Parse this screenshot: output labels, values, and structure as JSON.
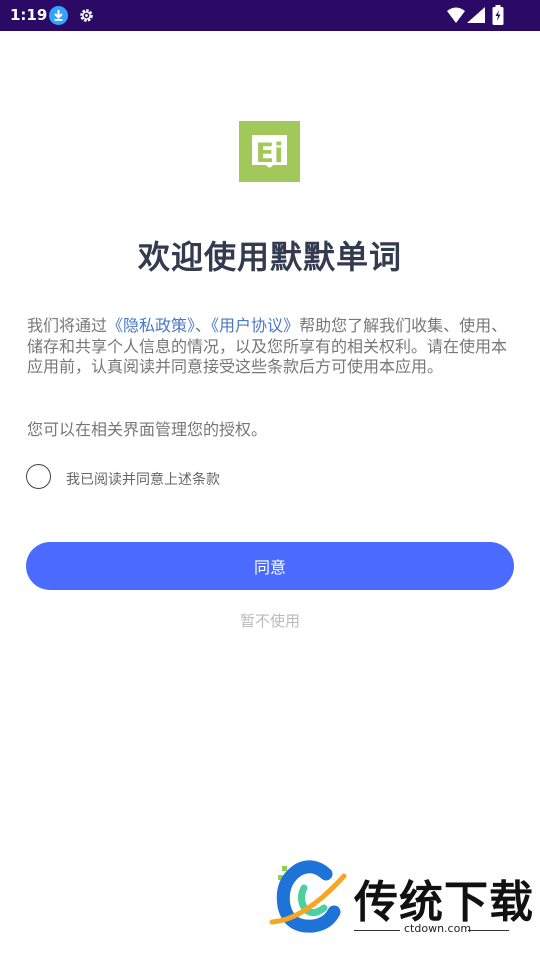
{
  "status_bar": {
    "time": "1:19",
    "bg_color": "#2a0a64",
    "icons": [
      "download-icon",
      "gear-icon",
      "wifi-icon",
      "signal-icon",
      "battery-icon"
    ]
  },
  "app": {
    "logo_letter": "Ei",
    "logo_color": "#a3c85a",
    "title": "欢迎使用默默单词"
  },
  "privacy": {
    "text_before": "我们将通过",
    "privacy_link": "《隐私政策》",
    "separator": "、",
    "agreement_link": "《用户协议》",
    "text_after": "帮助您了解我们收集、使用、储存和共享个人信息的情况，以及您所享有的相关权利。请在使用本应用前，认真阅读并同意接受这些条款后方可使用本应用。",
    "note": "您可以在相关界面管理您的授权。",
    "link_color": "#4a78c9"
  },
  "agree_checkbox": {
    "label": "我已阅读并同意上述条款",
    "checked": false
  },
  "buttons": {
    "agree": "同意",
    "decline": "暂不使用",
    "primary_color": "#4b6bff"
  },
  "watermark": {
    "name": "传统下载",
    "url": "ctdown.com"
  }
}
